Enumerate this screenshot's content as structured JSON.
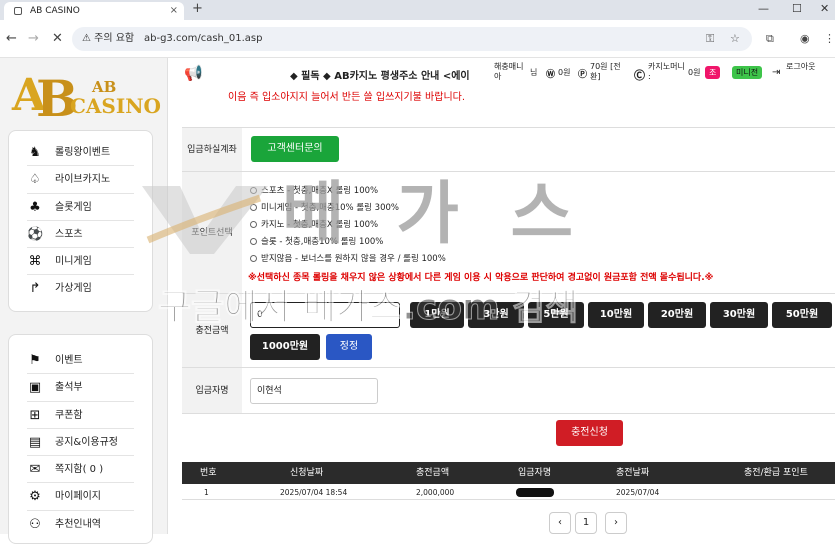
{
  "browser": {
    "tab_title": "AB CASINO",
    "tab_close": "×",
    "new_tab": "+",
    "security": "⚠ 주의 요함",
    "url": "ab-g3.com/cash_01.asp"
  },
  "sidebar": {
    "logo_text_top": "AB",
    "logo_text_bottom": "CASINO",
    "group1": [
      {
        "label": "롤링왕이벤트",
        "icon": "rolling-event-icon"
      },
      {
        "label": "라이브카지노",
        "icon": "spade-icon"
      },
      {
        "label": "슬롯게임",
        "icon": "slot-icon"
      },
      {
        "label": "스포츠",
        "icon": "soccer-ball-icon"
      },
      {
        "label": "미니게임",
        "icon": "gamepad-icon"
      },
      {
        "label": "가상게임",
        "icon": "virtual-game-icon"
      }
    ],
    "group2": [
      {
        "label": "이벤트",
        "icon": "event-icon"
      },
      {
        "label": "출석부",
        "icon": "attendance-icon"
      },
      {
        "label": "쿠폰함",
        "icon": "coupon-icon"
      },
      {
        "label": "공지&이용규정",
        "icon": "notice-icon"
      },
      {
        "label": "쪽지함( 0 )",
        "icon": "mail-icon"
      },
      {
        "label": "마이페이지",
        "icon": "user-settings-icon"
      },
      {
        "label": "추천인내역",
        "icon": "referral-icon"
      }
    ]
  },
  "topbar": {
    "notice": "◆ 필독 ◆ AB카지노 평생주소 안내 <에이",
    "user_suffix": "님",
    "nick": "해충매니아",
    "money_value": "0원",
    "point_label": "70원 [전환]",
    "casino_money_label": "카지노머니 :",
    "casino_money_value": "0원",
    "badge_red": "조",
    "badge_green": "미니전",
    "logout": "로그아웃",
    "badge_red_color": "#f0156a",
    "badge_green_color": "#3ec44a"
  },
  "main": {
    "top_notice": "이음 즉 입소아지지 늘어서 반든 쓸 입쓰지기불 바랍니다.",
    "deposit_account_label": "입금하실계좌",
    "cs_button": "고객센터문의",
    "point_select_label": "포인트선택",
    "options": [
      "스포츠 - 첫충,매충X 롤링 100%",
      "미니게임 - 첫충,매충10% 롤링 300%",
      "카지노 - 첫충,매충X 롤링 100%",
      "슬롯 - 첫충,매충10% 롤링 100%",
      "받지않음 - 보너스를 원하지 않을 경우 / 롤링 100%"
    ],
    "warning": "※선택하신 종목 롤링을 채우지 않은 상황에서 다른 게임 이용 시 악용으로 판단하여 경고없이 원금포함 전액 몰수됩니다.※",
    "charge_amount_label": "충전금액",
    "amount_input": "0",
    "amounts_row1": [
      "1만원",
      "3만원",
      "5만원",
      "10만원",
      "20만원",
      "30만원",
      "50만원"
    ],
    "amounts_row2": [
      "1000만원"
    ],
    "reset_button": "정정",
    "depositor_label": "입금자명",
    "depositor_value": "이현석",
    "submit_button": "충전신청"
  },
  "table": {
    "headers": [
      "번호",
      "신청날짜",
      "충전금액",
      "입금자명",
      "충전날짜",
      "충전/환급 포인트"
    ],
    "rows": [
      {
        "no": "1",
        "request_date": "2025/07/04 18:54",
        "amount": "2,000,000",
        "name": "",
        "charge_date": "2025/07/04",
        "points": ""
      }
    ]
  },
  "pagination": {
    "prev": "‹",
    "current": "1",
    "next": "›"
  },
  "watermark": {
    "big": "베 가 스",
    "search": "구글에서 베가스.com 검색"
  }
}
